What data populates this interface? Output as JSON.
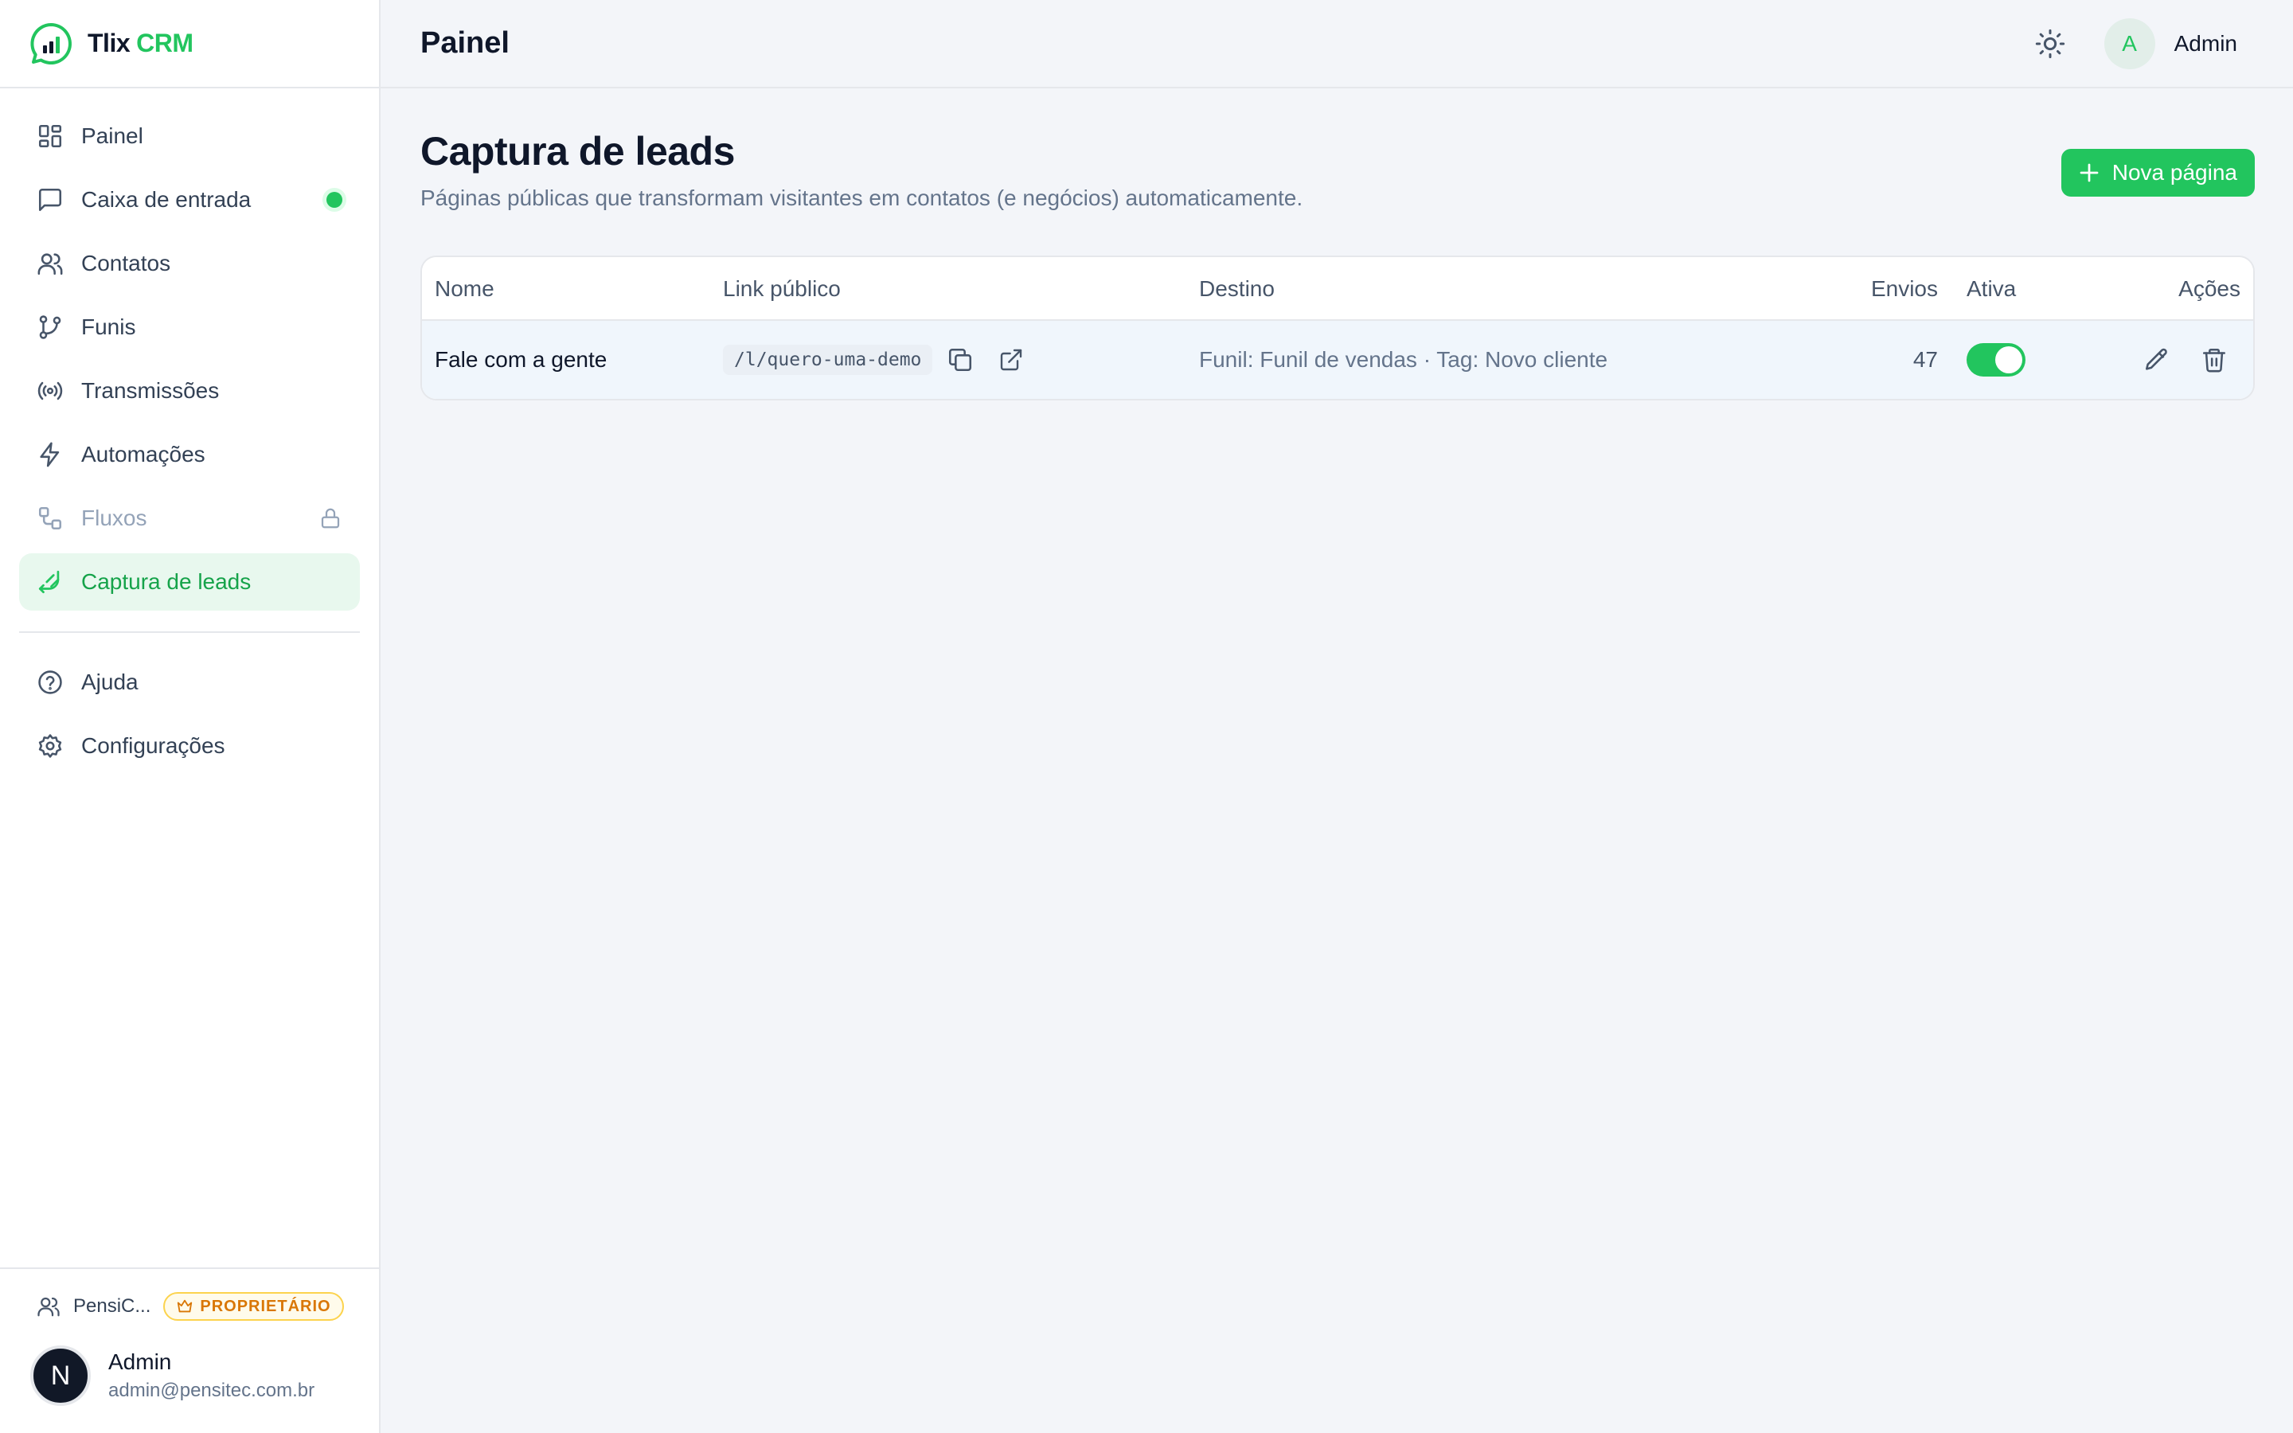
{
  "brand": {
    "name": "Tlix",
    "accent": "CRM",
    "accent_color": "#22c55e"
  },
  "sidebar": {
    "items": [
      {
        "label": "Painel",
        "icon": "dashboard-icon"
      },
      {
        "label": "Caixa de entrada",
        "icon": "message-square-icon",
        "indicator": "online-dot"
      },
      {
        "label": "Contatos",
        "icon": "users-icon"
      },
      {
        "label": "Funis",
        "icon": "git-branch-icon"
      },
      {
        "label": "Transmissões",
        "icon": "radio-icon"
      },
      {
        "label": "Automações",
        "icon": "zap-icon"
      },
      {
        "label": "Fluxos",
        "icon": "workflow-icon",
        "locked": true
      },
      {
        "label": "Captura de leads",
        "icon": "lead-capture-icon",
        "active": true
      }
    ],
    "secondary": [
      {
        "label": "Ajuda",
        "icon": "help-circle-icon"
      },
      {
        "label": "Configurações",
        "icon": "settings-icon"
      }
    ],
    "workspace": {
      "name": "PensiC...",
      "role": "PROPRIETÁRIO"
    },
    "user": {
      "initial": "N",
      "name": "Admin",
      "email": "admin@pensitec.com.br"
    }
  },
  "header": {
    "title": "Painel",
    "avatar_initial": "A",
    "user_name": "Admin"
  },
  "page": {
    "title": "Captura de leads",
    "subtitle": "Páginas públicas que transformam visitantes em contatos (e negócios) automaticamente.",
    "new_button": "Nova página"
  },
  "table": {
    "columns": {
      "name": "Nome",
      "link": "Link público",
      "destination": "Destino",
      "submissions": "Envios",
      "active": "Ativa",
      "actions": "Ações"
    },
    "rows": [
      {
        "name": "Fale com a gente",
        "link": "/l/quero-uma-demo",
        "destination": "Funil: Funil de vendas · Tag: Novo cliente",
        "submissions": "47",
        "active": true
      }
    ]
  }
}
